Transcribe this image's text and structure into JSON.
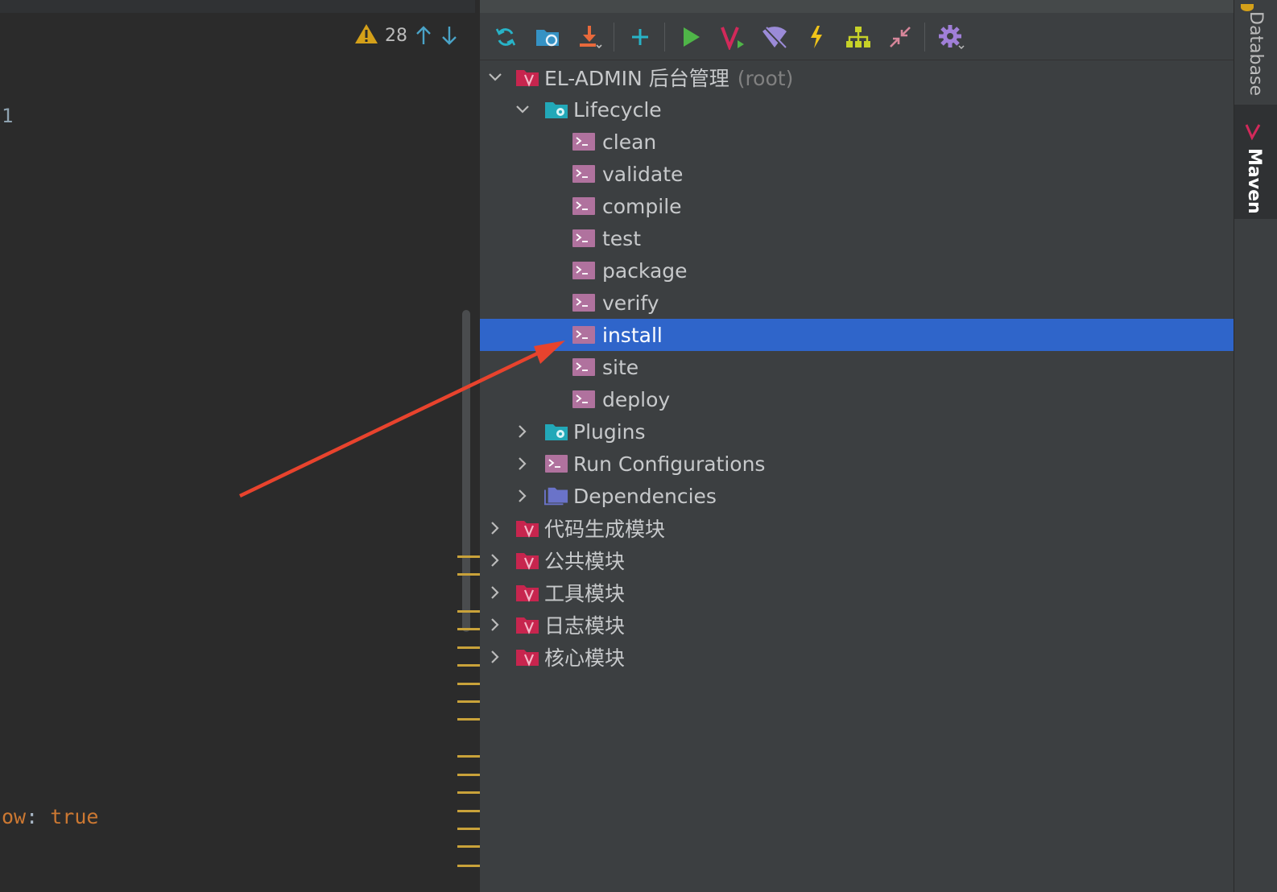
{
  "editor": {
    "inspection_count": "28",
    "line_number": "1",
    "code_key": "ow",
    "code_colon": ":",
    "code_value": "true"
  },
  "maven": {
    "toolbar": [
      {
        "name": "reload-icon"
      },
      {
        "name": "reimport-folder-icon"
      },
      {
        "name": "download-sources-icon"
      },
      {
        "name": "add-maven-project-icon"
      },
      {
        "name": "run-maven-build-icon"
      },
      {
        "name": "execute-maven-goal-icon"
      },
      {
        "name": "toggle-offline-mode-icon"
      },
      {
        "name": "skip-tests-icon"
      },
      {
        "name": "show-dependencies-icon"
      },
      {
        "name": "collapse-all-icon"
      },
      {
        "name": "maven-settings-icon"
      }
    ],
    "root": {
      "label": "EL-ADMIN 后台管理",
      "suffix": "(root)"
    },
    "lifecycle": {
      "label": "Lifecycle",
      "goals": [
        "clean",
        "validate",
        "compile",
        "test",
        "package",
        "verify",
        "install",
        "site",
        "deploy"
      ],
      "selected": "install"
    },
    "plugins": "Plugins",
    "run_configurations": "Run Configurations",
    "dependencies": "Dependencies",
    "modules": [
      "代码生成模块",
      "公共模块",
      "工具模块",
      "日志模块",
      "核心模块"
    ]
  },
  "right_sidebar": {
    "database": "Database",
    "maven": "Maven"
  },
  "colors": {
    "selection": "#2f65ca",
    "annotation_arrow": "#e8432d",
    "maven_icon": "#c7254e",
    "goal_icon": "#b0729e",
    "folder_teal": "#22a8b8"
  }
}
